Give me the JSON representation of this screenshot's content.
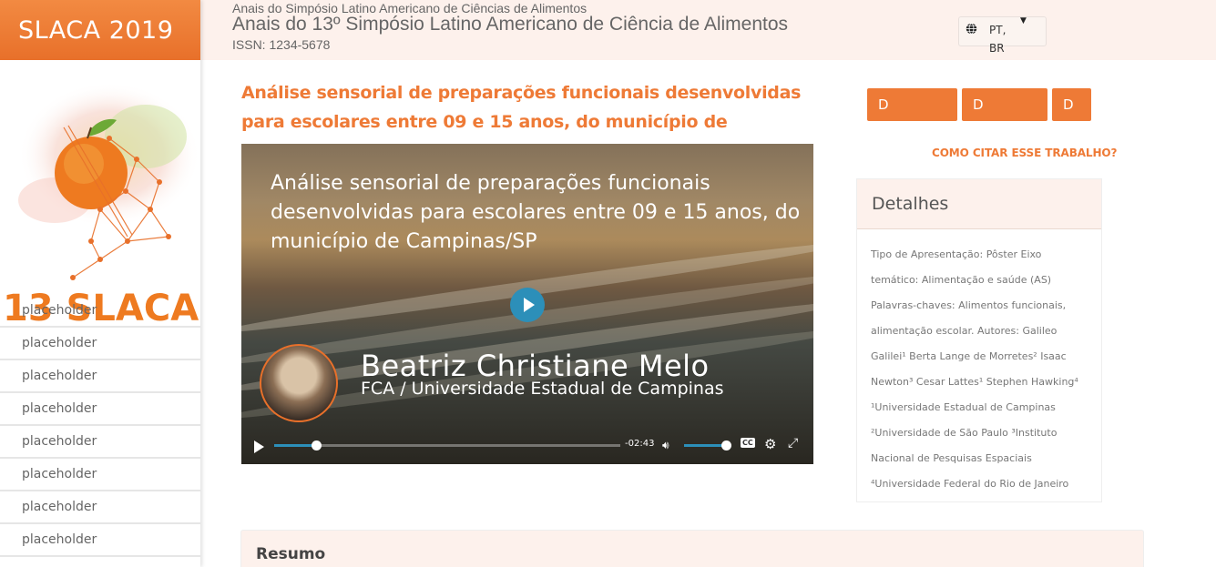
{
  "sidebar": {
    "brand": "SLACA 2019",
    "logo_text": "13 SLACA",
    "nav_items": [
      {
        "label": "placeholder"
      },
      {
        "label": "placeholder"
      },
      {
        "label": "placeholder"
      },
      {
        "label": "placeholder"
      },
      {
        "label": "placeholder"
      },
      {
        "label": "placeholder"
      },
      {
        "label": "placeholder"
      },
      {
        "label": "placeholder"
      }
    ]
  },
  "header": {
    "subtitle": "Anais do Simpósio Latino Americano de Ciências de Alimentos",
    "title": "Anais do 13º Simpósio Latino Americano de Ciência de Alimentos",
    "issn": "ISSN: 1234-5678",
    "language": "PT, BR",
    "language_icon": "globe-icon"
  },
  "paper": {
    "title": "Análise sensorial de preparações funcionais desenvolvidas para escolares entre 09 e 15 anos, do município de Campinas/SP"
  },
  "video": {
    "title": "Análise sensorial de preparações funcionais desenvolvidas para escolares entre 09 e 15 anos, do município de Campinas/SP",
    "speaker": "Beatriz Christiane Melo",
    "affiliation": "FCA / Universidade Estadual de Campinas",
    "time_remaining": "-02:43",
    "progress": 0.12,
    "volume": 1.0,
    "accent_color": "#2c8fb9"
  },
  "actions": {
    "buttons": [
      {
        "label": "D"
      },
      {
        "label": "D"
      },
      {
        "label": "D"
      }
    ],
    "cite_label": "COMO CITAR ESSE TRABALHO?"
  },
  "details": {
    "heading": "Detalhes",
    "body": "Tipo de Apresentação: Pôster Eixo temático: Alimentação e saúde (AS) Palavras-chaves: Alimentos funcionais, alimentação escolar. Autores: Galileo Galilei¹ Berta Lange de Morretes² Isaac Newton³ Cesar Lattes¹ Stephen Hawking⁴ ¹Universidade Estadual de Campinas ²Universidade de São Paulo ³Instituto Nacional de Pesquisas Espaciais ⁴Universidade Federal do Rio de Janeiro"
  },
  "resumo": {
    "heading": "Resumo"
  },
  "colors": {
    "brand": "#ee7a36",
    "header_bg": "#fdf1ec"
  }
}
